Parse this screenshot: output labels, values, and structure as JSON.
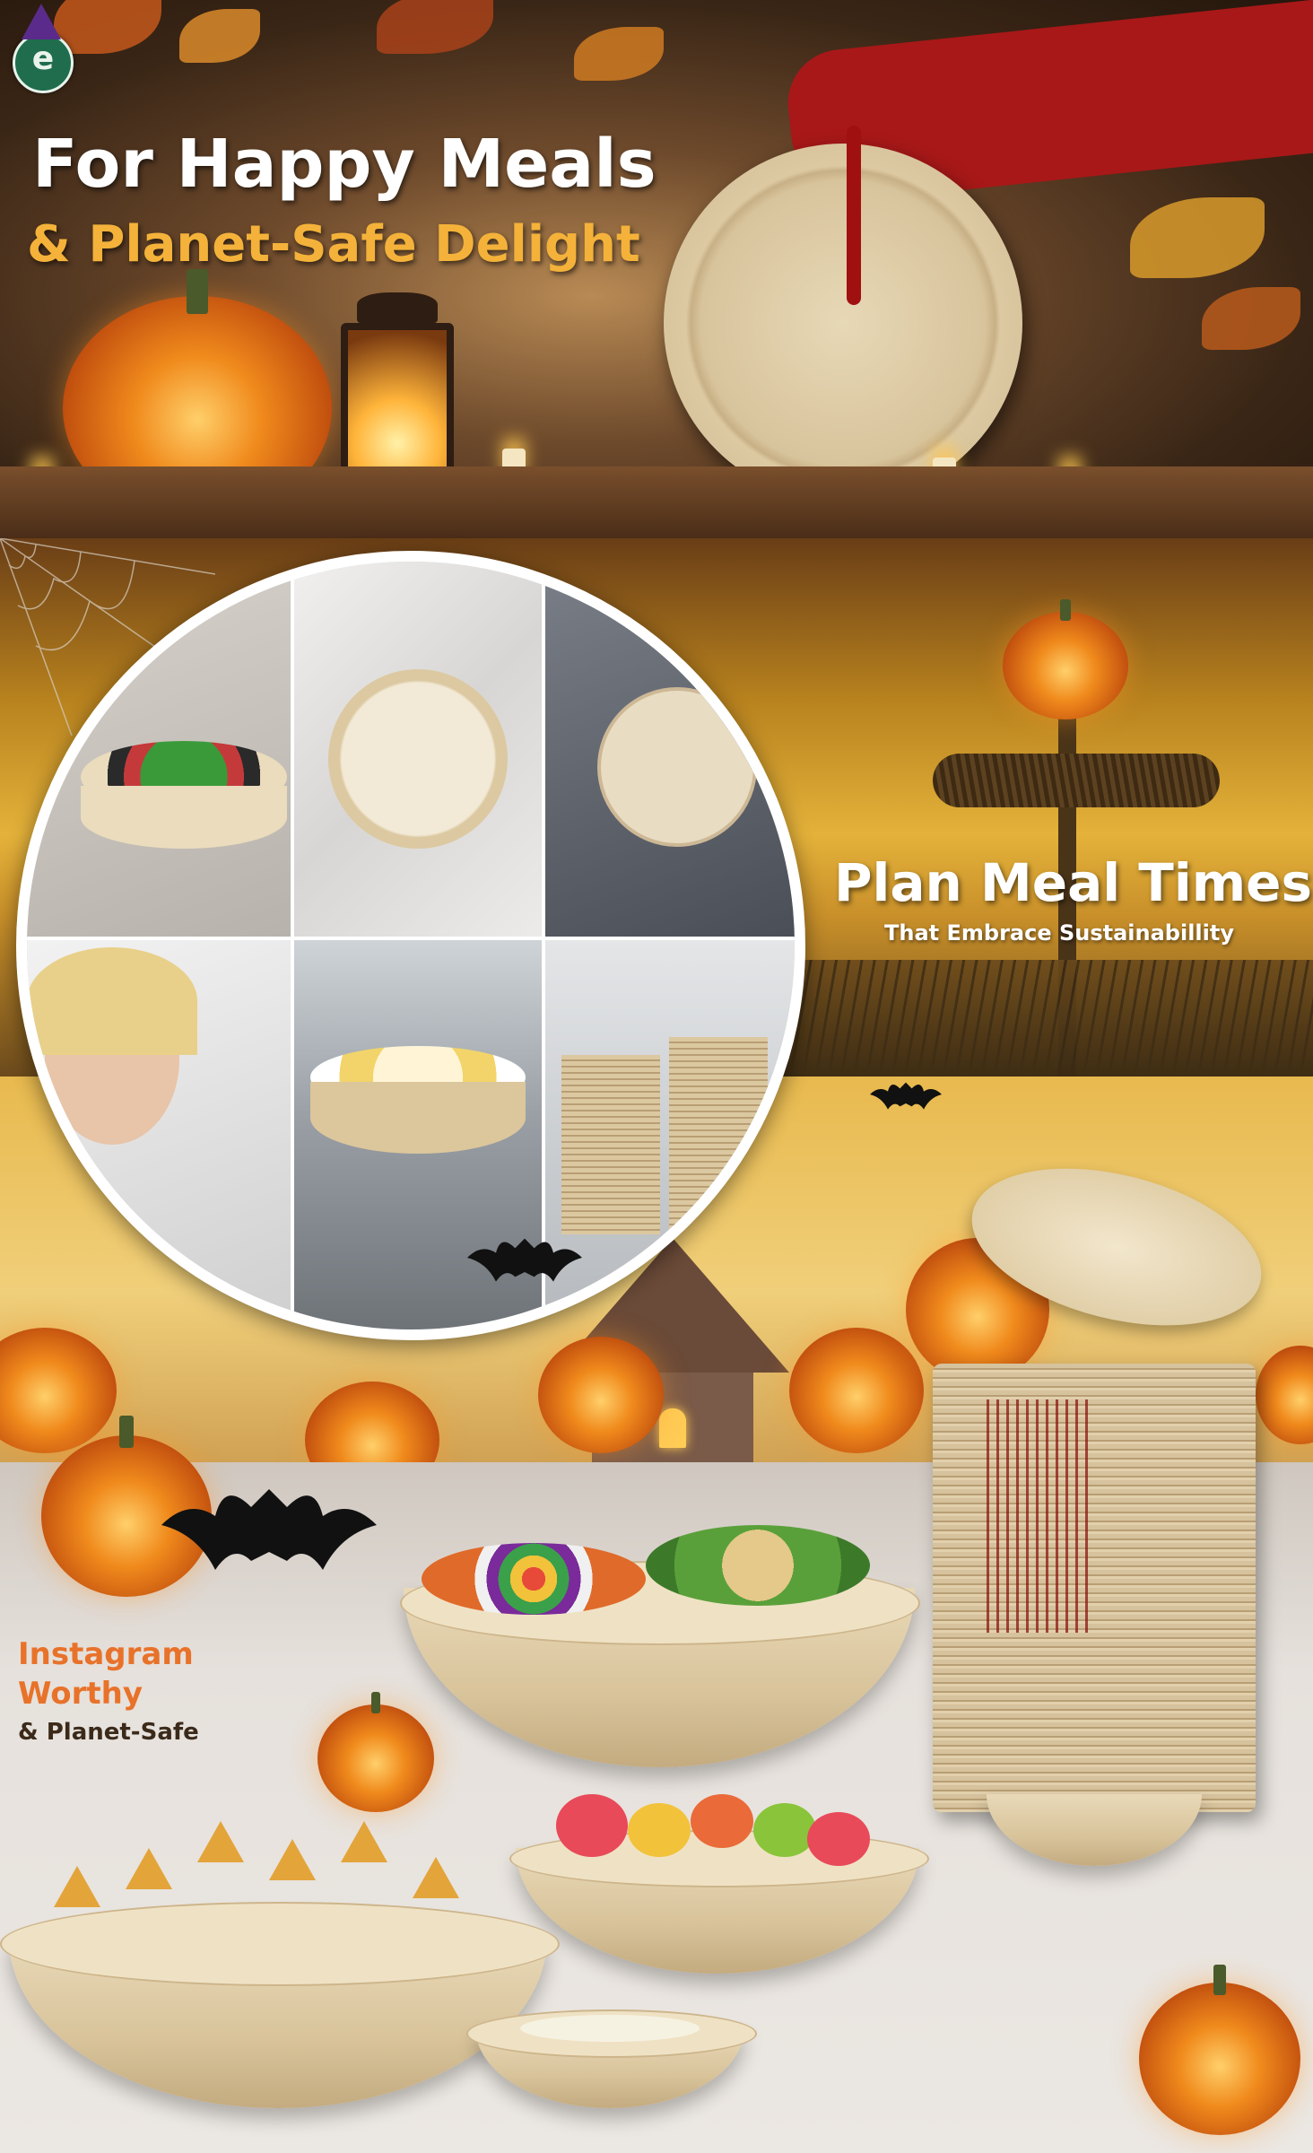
{
  "hero": {
    "headline_line1": "For Happy Meals",
    "headline_line2": "& Planet-Safe Delight",
    "colors": {
      "headline_white": "#ffffff",
      "headline_gold": "#f4b23a"
    }
  },
  "brand": {
    "logo_letter": "e",
    "logo_color": "#1f6d4d"
  },
  "section2": {
    "title": "Plan Meal Times",
    "subtitle": "That Embrace Sustainabillity"
  },
  "section3": {
    "cta_line1": "Instagram",
    "cta_line2": "Worthy",
    "cta_line3": "& Planet-Safe",
    "colors": {
      "cta_orange": "#e8722a",
      "cta_dark": "#3b2a1a"
    }
  },
  "icons": [
    "logo-icon",
    "pumpkin-icon",
    "lantern-icon",
    "bat-icon",
    "spiderweb-icon",
    "scarecrow-icon",
    "haunted-house-icon"
  ],
  "glyphs": {
    "pumpkin_face": "▲ ▲",
    "bat": "🦇"
  }
}
